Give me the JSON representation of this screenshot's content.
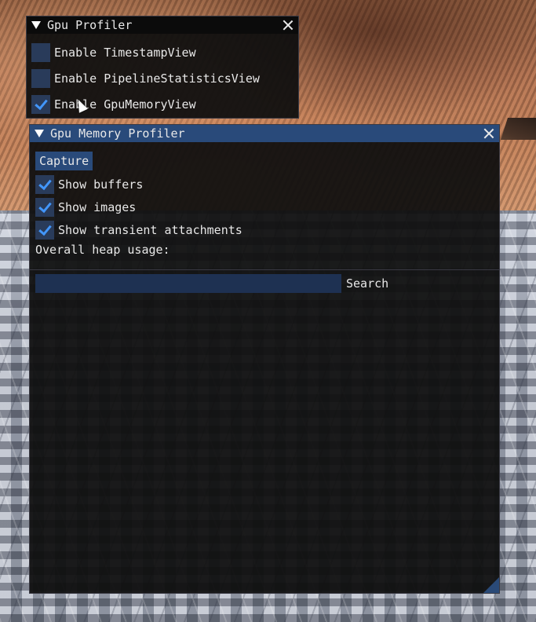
{
  "profiler_window": {
    "title": "Gpu Profiler",
    "options": [
      {
        "label": "Enable TimestampView",
        "checked": false
      },
      {
        "label": "Enable PipelineStatisticsView",
        "checked": false
      },
      {
        "label": "Enable GpuMemoryView",
        "checked": true
      }
    ]
  },
  "memory_window": {
    "title": "Gpu Memory Profiler",
    "capture_label": "Capture",
    "options": [
      {
        "label": "Show buffers",
        "checked": true
      },
      {
        "label": "Show images",
        "checked": true
      },
      {
        "label": "Show transient attachments",
        "checked": true
      }
    ],
    "heap_usage_label": "Overall heap usage:",
    "search": {
      "value": "",
      "button_label": "Search"
    }
  },
  "colors": {
    "title_active": "#294a7a",
    "checkbox_bg": "#293b5a",
    "checkmark": "#4296fa",
    "window_bg": "#0f0f0f"
  }
}
